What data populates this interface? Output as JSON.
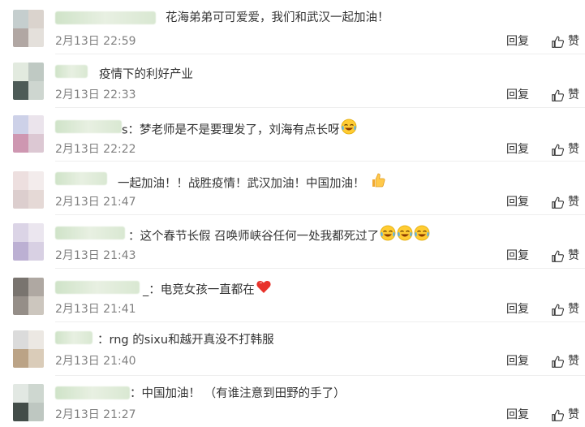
{
  "actions": {
    "reply_label": "回复",
    "like_label": "赞"
  },
  "comments": [
    {
      "text": "花海弟弟可可爱爱，我们和武汉一起加油！",
      "time": "2月13日 22:59"
    },
    {
      "text": "疫情下的利好产业",
      "time": "2月13日 22:33"
    },
    {
      "text": "s：梦老师是不是要理发了，刘海有点长呀",
      "time": "2月13日 22:22",
      "emoji": [
        "laugh-cry-icon"
      ]
    },
    {
      "text": "一起加油！！战胜疫情！武汉加油！中国加油！",
      "time": "2月13日 21:47",
      "emoji": [
        "thumbs-up-icon"
      ]
    },
    {
      "text": "：这个春节长假 召唤师峡谷任何一处我都死过了",
      "time": "2月13日 21:43",
      "emoji": [
        "laugh-cry-icon",
        "laugh-cry-icon",
        "laugh-cry-icon"
      ]
    },
    {
      "text": "_：电竞女孩一直都在",
      "time": "2月13日 21:41",
      "emoji": [
        "heart-icon"
      ]
    },
    {
      "text": "：rng 的sixu和越开真没不打韩服",
      "time": "2月13日 21:40"
    },
    {
      "text": "：中国加油！ （有谁注意到田野的手了）",
      "time": "2月13日 21:27"
    }
  ],
  "colors": {
    "text": "#333333",
    "meta": "#808080",
    "divider": "#eeeeee",
    "heart": "#e8322b",
    "emoji_face": "#ffcc33"
  }
}
